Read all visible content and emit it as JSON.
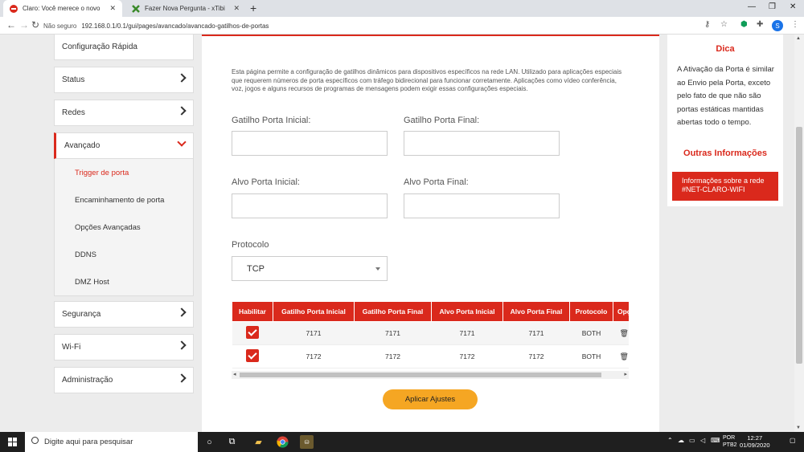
{
  "browser": {
    "tabs": [
      {
        "title": "Claro: Você merece o novo",
        "active": true
      },
      {
        "title": "Fazer Nova Pergunta - xTibia - S",
        "active": false
      }
    ],
    "security_label": "Não seguro",
    "url": "192.168.0.1/0.1/gui/pages/avancado/avancado-gatilhos-de-portas",
    "profile_initial": "S"
  },
  "sidebar": {
    "items": [
      {
        "label": "Configuração Rápida"
      },
      {
        "label": "Status"
      },
      {
        "label": "Redes"
      },
      {
        "label": "Avançado",
        "expanded": true
      },
      {
        "label": "Segurança"
      },
      {
        "label": "Wi-Fi"
      },
      {
        "label": "Administração"
      }
    ],
    "submenu": [
      {
        "label": "Trigger de porta",
        "active": true
      },
      {
        "label": "Encaminhamento de porta"
      },
      {
        "label": "Opções Avançadas"
      },
      {
        "label": "DDNS"
      },
      {
        "label": "DMZ Host"
      }
    ]
  },
  "main": {
    "description": "Esta página permite a configuração de gatilhos dinâmicos para dispositivos específicos na rede LAN. Utilizado para aplicações especiais que requerem números de porta específicos com tráfego bidirecional para funcionar corretamente. Aplicações como vídeo conferência, voz, jogos e alguns recursos de programas de mensagens podem exigir essas configurações especiais.",
    "fields": {
      "trigger_start": {
        "label": "Gatilho Porta Inicial:",
        "value": ""
      },
      "trigger_end": {
        "label": "Gatilho Porta Final:",
        "value": ""
      },
      "target_start": {
        "label": "Alvo Porta Inicial:",
        "value": ""
      },
      "target_end": {
        "label": "Alvo Porta Final:",
        "value": ""
      }
    },
    "protocol": {
      "label": "Protocolo",
      "selected": "TCP"
    },
    "table": {
      "columns": [
        "Habilitar",
        "Gatilho Porta Inicial",
        "Gatilho Porta Final",
        "Alvo Porta Inicial",
        "Alvo Porta Final",
        "Protocolo",
        "Opções"
      ],
      "rows": [
        {
          "enabled": true,
          "trigger_start": "7171",
          "trigger_end": "7171",
          "target_start": "7171",
          "target_end": "7171",
          "protocol": "BOTH"
        },
        {
          "enabled": true,
          "trigger_start": "7172",
          "trigger_end": "7172",
          "target_start": "7172",
          "target_end": "7172",
          "protocol": "BOTH"
        }
      ]
    },
    "apply_label": "Aplicar Ajustes"
  },
  "tip": {
    "title": "Dica",
    "text": "A Ativação da Porta é similar ao Envio pela Porta, exceto pelo fato de que não são portas estáticas mantidas abertas todo o tempo.",
    "more_title": "Outras Informações",
    "more_button": "Informações sobre a rede #NET-CLARO-WIFI"
  },
  "taskbar": {
    "search_placeholder": "Digite aqui para pesquisar",
    "lang_line1": "POR",
    "lang_line2": "PTB2",
    "time": "12:27",
    "date": "01/09/2020"
  },
  "colors": {
    "accent": "#da291c",
    "button": "#f5a623"
  }
}
